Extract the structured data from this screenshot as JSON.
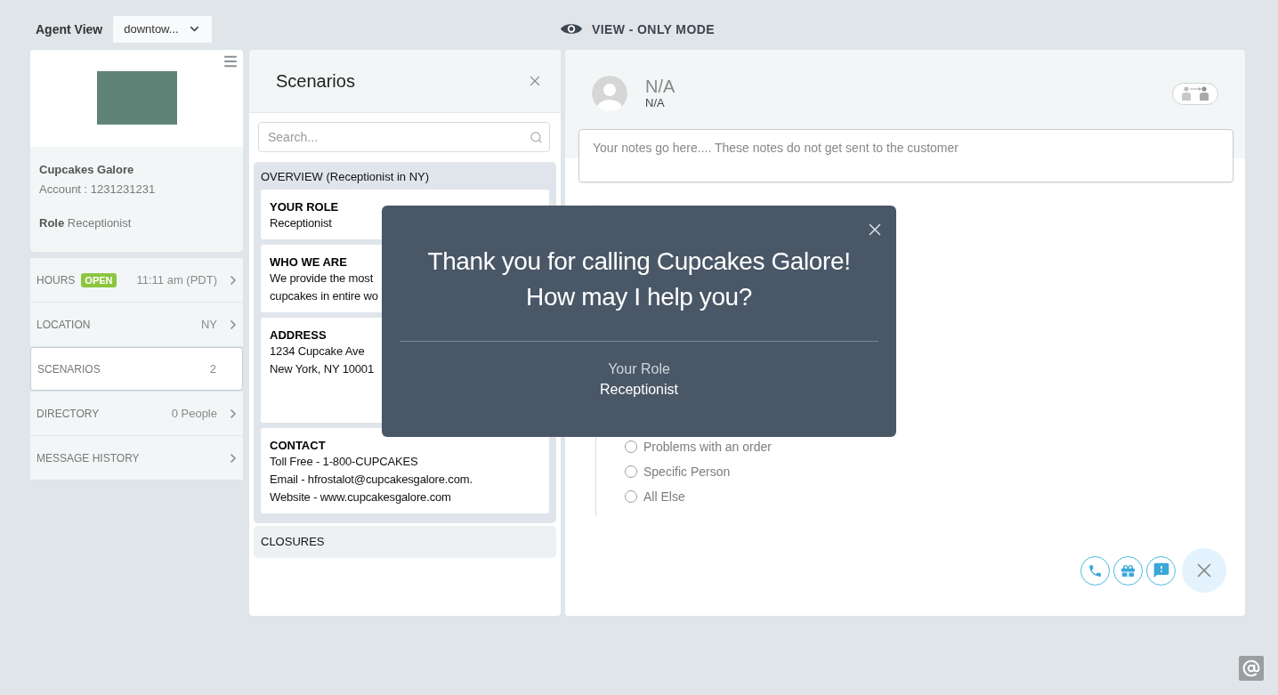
{
  "header": {
    "title": "Agent View",
    "location_select": {
      "value": "downtow..."
    },
    "mode_label": "VIEW - ONLY MODE"
  },
  "profile": {
    "business_name": "Cupcakes Galore",
    "account": "Account : 1231231231",
    "role_label": "Role",
    "role_value": "Receptionist"
  },
  "nav": [
    {
      "label": "HOURS",
      "badge": "OPEN",
      "value": "11:11 am (PDT)",
      "selected": false
    },
    {
      "label": "LOCATION",
      "value": "NY",
      "selected": false
    },
    {
      "label": "SCENARIOS",
      "value": "2",
      "selected": true
    },
    {
      "label": "DIRECTORY",
      "value": "0 People",
      "selected": false
    },
    {
      "label": "MESSAGE HISTORY",
      "selected": false
    }
  ],
  "scenarios_panel": {
    "title": "Scenarios",
    "search": {
      "placeholder": "Search..."
    },
    "sections": [
      {
        "title": "OVERVIEW (Receptionist in NY)",
        "expanded": true,
        "cards": [
          {
            "heading": "YOUR ROLE",
            "lines": [
              "Receptionist"
            ]
          },
          {
            "heading": "WHO WE ARE",
            "lines": [
              "We provide the most",
              "cupcakes in entire wo"
            ]
          },
          {
            "heading": "ADDRESS",
            "lines": [
              "1234 Cupcake Ave",
              "New York, NY 10001"
            ]
          },
          {
            "heading": "CONTACT",
            "lines": [
              "Toll Free - 1-800-CUPCAKES",
              "Email - hfrostalot@cupcakesgalore.com.",
              "Website - www.cupcakesgalore.com"
            ]
          }
        ]
      },
      {
        "title": "CLOSURES",
        "expanded": false
      }
    ]
  },
  "contact": {
    "name": "N/A",
    "subtitle": "N/A",
    "notes": {
      "placeholder": "Your notes go here.... These notes do not get sent to the customer"
    }
  },
  "form": {
    "options": [
      {
        "label": "Problems with an order",
        "selected": false
      },
      {
        "label": "Specific Person",
        "selected": false
      },
      {
        "label": "All Else",
        "selected": false
      }
    ]
  },
  "actions": [
    {
      "kind": "phone"
    },
    {
      "kind": "gift"
    },
    {
      "kind": "alert"
    },
    {
      "kind": "close"
    }
  ],
  "greeting_popup": {
    "message_lines": [
      "Thank you for calling Cupcakes Galore!",
      "How may I help you?"
    ],
    "role_label": "Your Role",
    "role_value": "Receptionist"
  }
}
